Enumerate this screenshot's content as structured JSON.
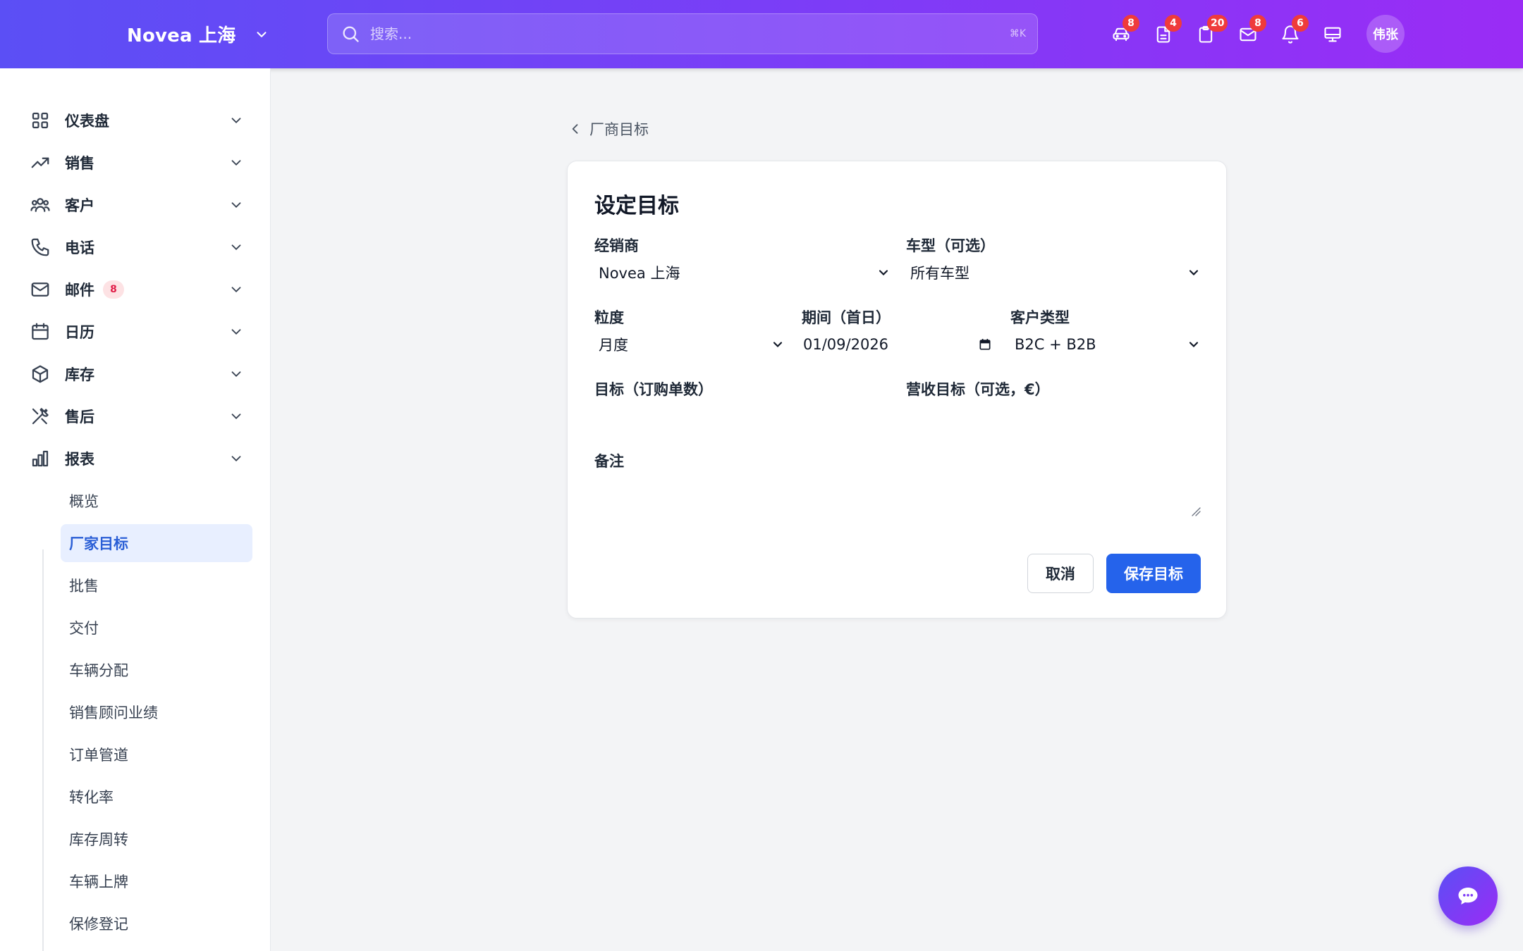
{
  "header": {
    "brand": "Novea 上海",
    "search_placeholder": "搜索...",
    "search_shortcut": "⌘K",
    "icons": [
      {
        "name": "car-icon",
        "badge": "8"
      },
      {
        "name": "document-icon",
        "badge": "4"
      },
      {
        "name": "clipboard-icon",
        "badge": "20"
      },
      {
        "name": "mail-icon",
        "badge": "8"
      },
      {
        "name": "bell-icon",
        "badge": "6"
      },
      {
        "name": "monitor-icon",
        "badge": ""
      }
    ],
    "avatar": "伟张",
    "colors": {
      "gradient_start": "#5b4ff5",
      "gradient_end": "#9a2cf5",
      "badge": "#ef3b3b"
    }
  },
  "sidebar": {
    "items": [
      {
        "label": "仪表盘",
        "icon": "grid-icon"
      },
      {
        "label": "销售",
        "icon": "trending-up-icon"
      },
      {
        "label": "客户",
        "icon": "users-icon"
      },
      {
        "label": "电话",
        "icon": "phone-icon"
      },
      {
        "label": "邮件",
        "icon": "mail-icon",
        "badge": "8"
      },
      {
        "label": "日历",
        "icon": "calendar-icon"
      },
      {
        "label": "库存",
        "icon": "box-icon"
      },
      {
        "label": "售后",
        "icon": "tools-icon"
      },
      {
        "label": "报表",
        "icon": "bar-chart-icon"
      }
    ],
    "sub_items": [
      "概览",
      "厂家目标",
      "批售",
      "交付",
      "车辆分配",
      "销售顾问业绩",
      "订单管道",
      "转化率",
      "库存周转",
      "车辆上牌",
      "保修登记"
    ],
    "active_sub": "厂家目标",
    "colors": {
      "active_bg": "#e8efff",
      "active_text": "#2b5fd6"
    }
  },
  "breadcrumb": {
    "back_label": "厂商目标"
  },
  "form": {
    "title": "设定目标",
    "dealer": {
      "label": "经销商",
      "value": "Novea 上海"
    },
    "model": {
      "label": "车型（可选）",
      "value": "所有车型"
    },
    "granularity": {
      "label": "粒度",
      "value": "月度"
    },
    "period": {
      "label": "期间（首日）",
      "value": "01/09/2026"
    },
    "customer_type": {
      "label": "客户类型",
      "value": "B2C + B2B"
    },
    "target_orders": {
      "label": "目标（订购单数）",
      "value": ""
    },
    "revenue_target": {
      "label": "营收目标（可选，€）",
      "value": ""
    },
    "notes": {
      "label": "备注",
      "value": ""
    },
    "cancel_label": "取消",
    "save_label": "保存目标",
    "colors": {
      "primary": "#2563eb"
    }
  }
}
